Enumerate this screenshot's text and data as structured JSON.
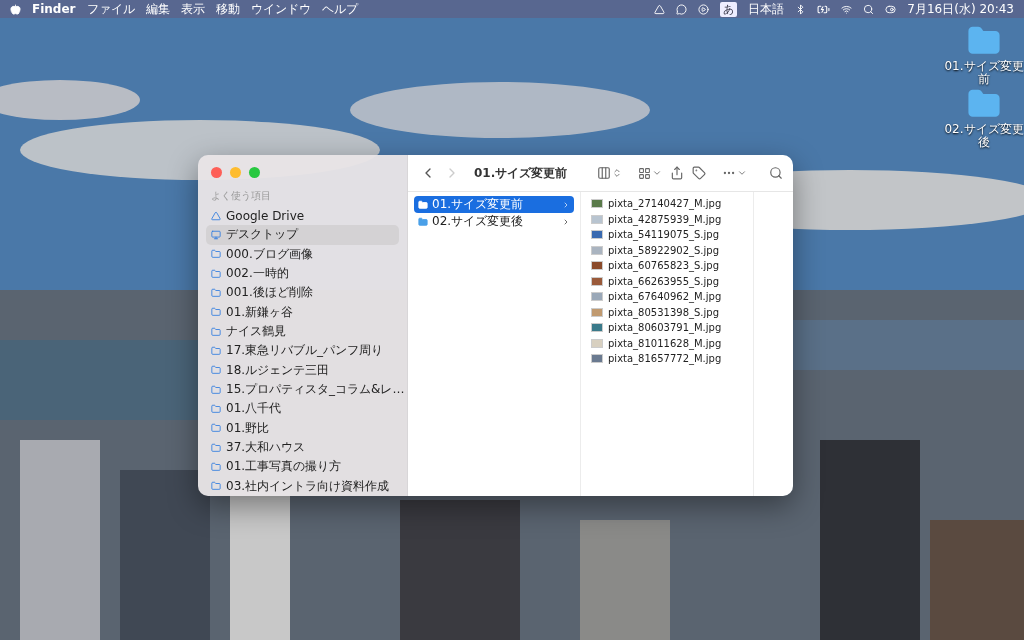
{
  "menu_bar": {
    "app": "Finder",
    "menus": [
      "ファイル",
      "編集",
      "表示",
      "移動",
      "ウインドウ",
      "ヘルプ"
    ],
    "input_mode": "あ",
    "input_language": "日本語",
    "clock": "7月16日(水) 20:43"
  },
  "desktop_icons": [
    {
      "label": "01.サイズ変更前"
    },
    {
      "label": "02.サイズ変更後"
    }
  ],
  "finder": {
    "title": "01.サイズ変更前",
    "back_disabled": false,
    "forward_disabled": true,
    "sidebar": {
      "section": "よく使う項目",
      "items": [
        {
          "kind": "drive",
          "label": "Google Drive",
          "selected": false
        },
        {
          "kind": "desktop",
          "label": "デスクトップ",
          "selected": true
        },
        {
          "kind": "folder",
          "label": "000.ブログ画像",
          "selected": false
        },
        {
          "kind": "folder",
          "label": "002.一時的",
          "selected": false
        },
        {
          "kind": "folder",
          "label": "001.後ほど削除",
          "selected": false
        },
        {
          "kind": "folder",
          "label": "01.新鎌ヶ谷",
          "selected": false
        },
        {
          "kind": "folder",
          "label": "ナイス鶴見",
          "selected": false
        },
        {
          "kind": "folder",
          "label": "17.東急リバブル_パンフ周り",
          "selected": false
        },
        {
          "kind": "folder",
          "label": "18.ルジェンテ三田",
          "selected": false
        },
        {
          "kind": "folder",
          "label": "15.プロパティスタ_コラム&レ…",
          "selected": false
        },
        {
          "kind": "folder",
          "label": "01.八千代",
          "selected": false
        },
        {
          "kind": "folder",
          "label": "01.野比",
          "selected": false
        },
        {
          "kind": "folder",
          "label": "37.大和ハウス",
          "selected": false
        },
        {
          "kind": "folder",
          "label": "01.工事写真の撮り方",
          "selected": false
        },
        {
          "kind": "folder",
          "label": "03.社内イントラ向け資料作成",
          "selected": false
        }
      ]
    },
    "folders": [
      {
        "label": "01.サイズ変更前",
        "selected": true
      },
      {
        "label": "02.サイズ変更後",
        "selected": false
      }
    ],
    "files": [
      {
        "name": "pixta_27140427_M.jpg",
        "color": "#5a7a4a"
      },
      {
        "name": "pixta_42875939_M.jpg",
        "color": "#b8c4d0"
      },
      {
        "name": "pixta_54119075_S.jpg",
        "color": "#3a6ab0"
      },
      {
        "name": "pixta_58922902_S.jpg",
        "color": "#aab4c0"
      },
      {
        "name": "pixta_60765823_S.jpg",
        "color": "#8a4a2a"
      },
      {
        "name": "pixta_66263955_S.jpg",
        "color": "#9a5a3a"
      },
      {
        "name": "pixta_67640962_M.jpg",
        "color": "#9aa8b8"
      },
      {
        "name": "pixta_80531398_S.jpg",
        "color": "#c09a70"
      },
      {
        "name": "pixta_80603791_M.jpg",
        "color": "#3a7a8a"
      },
      {
        "name": "pixta_81011628_M.jpg",
        "color": "#d8d0c0"
      },
      {
        "name": "pixta_81657772_M.jpg",
        "color": "#6a7a90"
      }
    ]
  }
}
